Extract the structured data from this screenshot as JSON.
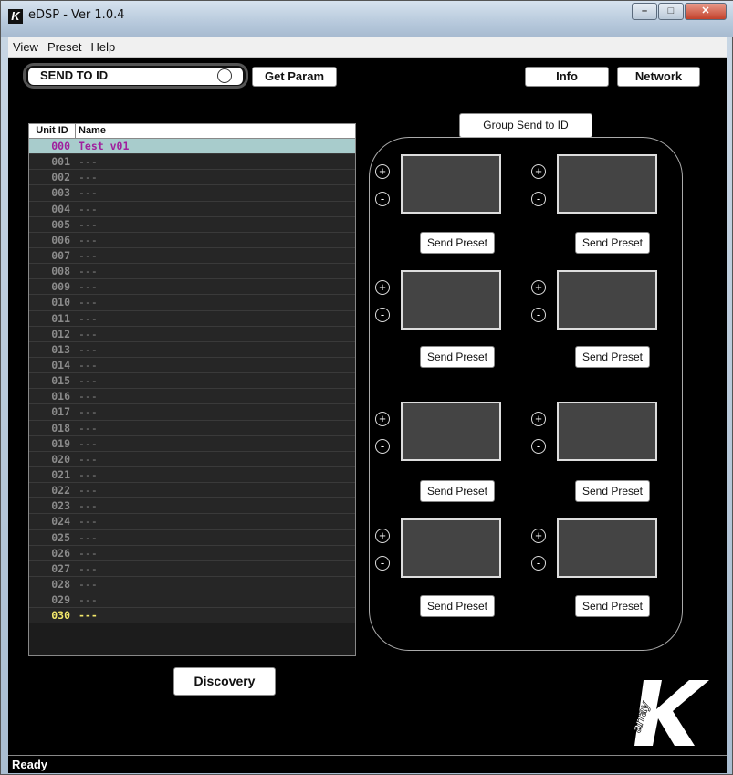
{
  "window": {
    "title": "eDSP - Ver 1.0.4"
  },
  "menu": [
    "View",
    "Preset",
    "Help"
  ],
  "top": {
    "send_to_id": "SEND TO ID",
    "get_param": "Get Param",
    "info": "Info",
    "network": "Network"
  },
  "table": {
    "headers": {
      "id": "Unit ID",
      "name": "Name"
    },
    "rows": [
      {
        "id": "000",
        "name": "Test v01"
      },
      {
        "id": "001",
        "name": "---"
      },
      {
        "id": "002",
        "name": "---"
      },
      {
        "id": "003",
        "name": "---"
      },
      {
        "id": "004",
        "name": "---"
      },
      {
        "id": "005",
        "name": "---"
      },
      {
        "id": "006",
        "name": "---"
      },
      {
        "id": "007",
        "name": "---"
      },
      {
        "id": "008",
        "name": "---"
      },
      {
        "id": "009",
        "name": "---"
      },
      {
        "id": "010",
        "name": "---"
      },
      {
        "id": "011",
        "name": "---"
      },
      {
        "id": "012",
        "name": "---"
      },
      {
        "id": "013",
        "name": "---"
      },
      {
        "id": "014",
        "name": "---"
      },
      {
        "id": "015",
        "name": "---"
      },
      {
        "id": "016",
        "name": "---"
      },
      {
        "id": "017",
        "name": "---"
      },
      {
        "id": "018",
        "name": "---"
      },
      {
        "id": "019",
        "name": "---"
      },
      {
        "id": "020",
        "name": "---"
      },
      {
        "id": "021",
        "name": "---"
      },
      {
        "id": "022",
        "name": "---"
      },
      {
        "id": "023",
        "name": "---"
      },
      {
        "id": "024",
        "name": "---"
      },
      {
        "id": "025",
        "name": "---"
      },
      {
        "id": "026",
        "name": "---"
      },
      {
        "id": "027",
        "name": "---"
      },
      {
        "id": "028",
        "name": "---"
      },
      {
        "id": "029",
        "name": "---"
      },
      {
        "id": "030",
        "name": "---"
      }
    ]
  },
  "discovery": "Discovery",
  "group": {
    "title": "Group Send to ID",
    "plus": "+",
    "minus": "-",
    "send_preset": "Send Preset"
  },
  "logo": {
    "text": "array",
    "letter": "K"
  },
  "status": "Ready",
  "colors": {
    "selected_row": "#a8cccc",
    "selected_text": "#a0209e",
    "last_row_text": "#f3e86a"
  }
}
